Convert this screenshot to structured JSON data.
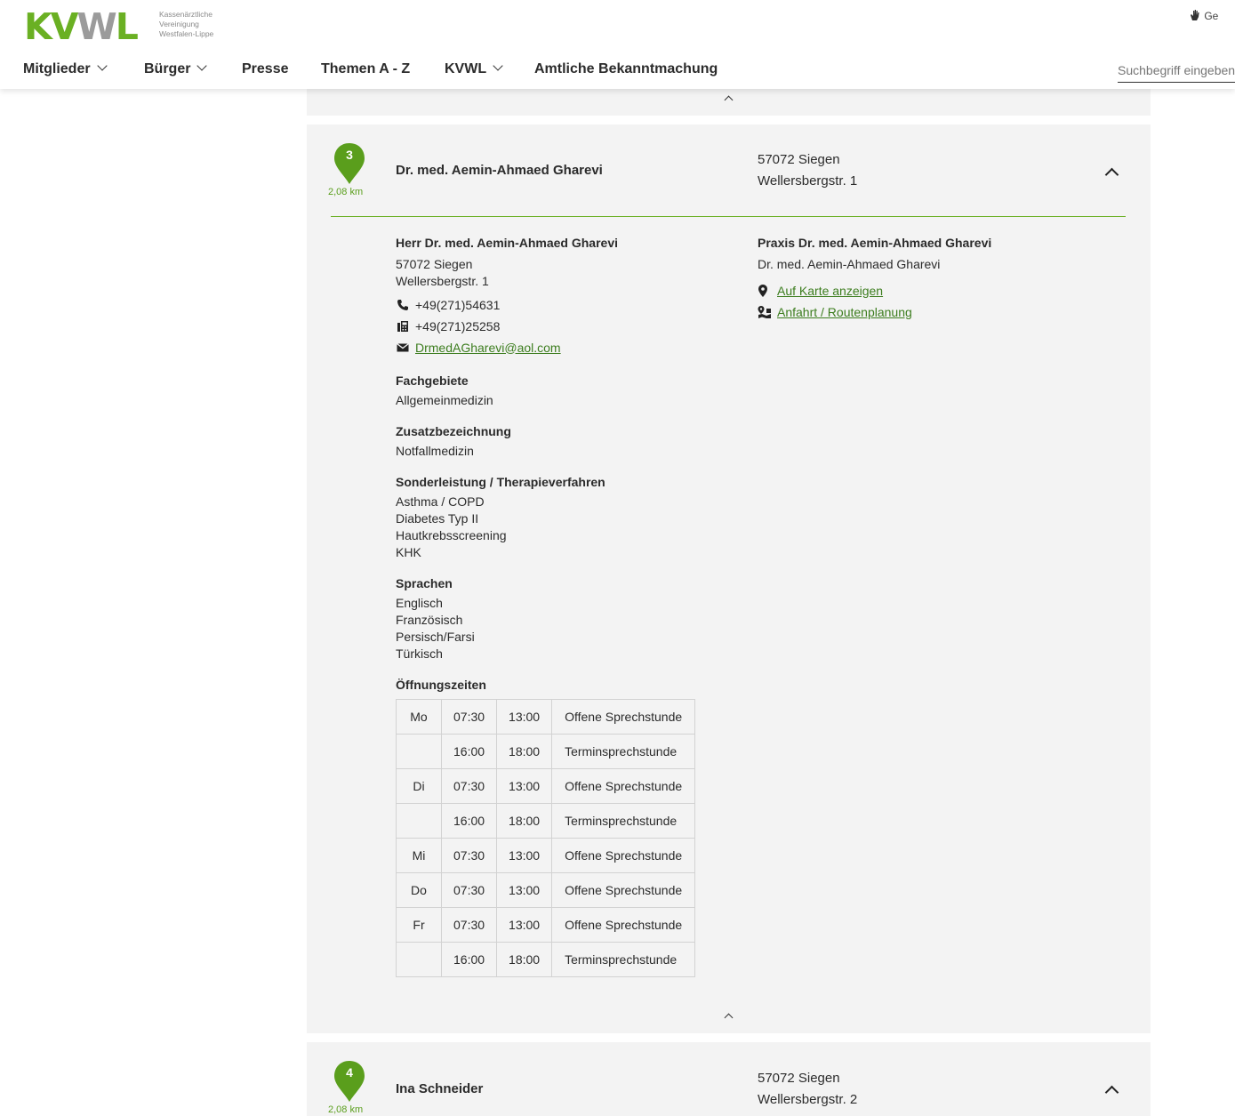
{
  "header": {
    "logo": {
      "mark": "KVWL",
      "lines": [
        "Kassenärztliche",
        "Vereinigung",
        "Westfalen-Lippe"
      ]
    },
    "helper_text": "Ge",
    "nav": [
      {
        "label": "Mitglieder",
        "dropdown": true
      },
      {
        "label": "Bürger",
        "dropdown": true
      },
      {
        "label": "Presse",
        "dropdown": false
      },
      {
        "label": "Themen A - Z",
        "dropdown": false
      },
      {
        "label": "KVWL",
        "dropdown": true
      },
      {
        "label": "Amtliche Bekanntmachung",
        "dropdown": false
      }
    ],
    "search_placeholder": "Suchbegriff eingeben"
  },
  "results": [
    {
      "number": "3",
      "distance": "2,08 km",
      "name": "Dr. med. Aemin-Ahmaed Gharevi",
      "city": "57072 Siegen",
      "street": "Wellersbergstr. 1",
      "expanded": true,
      "details": {
        "full_name": "Herr Dr. med. Aemin-Ahmaed Gharevi",
        "city": "57072 Siegen",
        "street": "Wellersbergstr. 1",
        "phone": "+49(271)54631",
        "fax": "+49(271)25258",
        "email": "DrmedAGharevi@aol.com",
        "sections": [
          {
            "title": "Fachgebiete",
            "items": [
              "Allgemeinmedizin"
            ]
          },
          {
            "title": "Zusatzbezeichnung",
            "items": [
              "Notfallmedizin"
            ]
          },
          {
            "title": "Sonderleistung / Therapieverfahren",
            "items": [
              "Asthma / COPD",
              "Diabetes Typ II",
              "Hautkrebsscreening",
              "KHK"
            ]
          },
          {
            "title": "Sprachen",
            "items": [
              "Englisch",
              "Französisch",
              "Persisch/Farsi",
              "Türkisch"
            ]
          }
        ],
        "hours_title": "Öffnungszeiten",
        "hours": [
          {
            "day": "Mo",
            "from": "07:30",
            "to": "13:00",
            "type": "Offene Sprechstunde"
          },
          {
            "day": "",
            "from": "16:00",
            "to": "18:00",
            "type": "Terminsprechstunde"
          },
          {
            "day": "Di",
            "from": "07:30",
            "to": "13:00",
            "type": "Offene Sprechstunde"
          },
          {
            "day": "",
            "from": "16:00",
            "to": "18:00",
            "type": "Terminsprechstunde"
          },
          {
            "day": "Mi",
            "from": "07:30",
            "to": "13:00",
            "type": "Offene Sprechstunde"
          },
          {
            "day": "Do",
            "from": "07:30",
            "to": "13:00",
            "type": "Offene Sprechstunde"
          },
          {
            "day": "Fr",
            "from": "07:30",
            "to": "13:00",
            "type": "Offene Sprechstunde"
          },
          {
            "day": "",
            "from": "16:00",
            "to": "18:00",
            "type": "Terminsprechstunde"
          }
        ],
        "practice_title": "Praxis Dr. med. Aemin-Ahmaed Gharevi",
        "practice_member": "Dr. med. Aemin-Ahmaed Gharevi",
        "map_link": "Auf Karte anzeigen",
        "route_link": "Anfahrt / Routenplanung"
      }
    },
    {
      "number": "4",
      "distance": "2,08 km",
      "name": "Ina Schneider",
      "city": "57072 Siegen",
      "street": "Wellersbergstr. 2",
      "expanded": false
    }
  ],
  "colors": {
    "brand_green": "#6ab023",
    "link_green": "#3c7d1e",
    "panel_bg": "#f3f3f3",
    "logo_grey": "#9b9b9b"
  },
  "icons": [
    "pin-marker-icon",
    "phone-icon",
    "fax-icon",
    "mail-icon",
    "map-marker-icon",
    "route-icon",
    "chevron-up-icon",
    "chevron-down-icon",
    "hand-icon"
  ]
}
